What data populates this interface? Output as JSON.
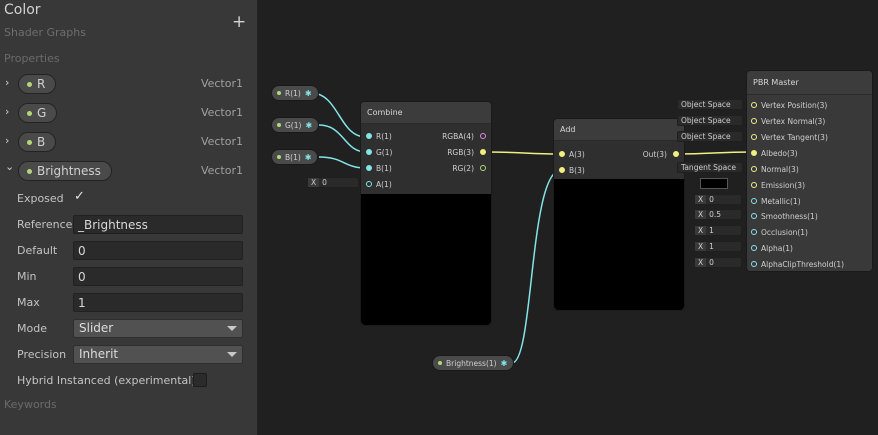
{
  "blackboard": {
    "title": "Color",
    "subtitle": "Shader Graphs",
    "add_label": "+",
    "properties_header": "Properties",
    "keywords_header": "Keywords",
    "properties": [
      {
        "name": "R",
        "type": "Vector1",
        "expanded": false
      },
      {
        "name": "G",
        "type": "Vector1",
        "expanded": false
      },
      {
        "name": "B",
        "type": "Vector1",
        "expanded": false
      },
      {
        "name": "Brightness",
        "type": "Vector1",
        "expanded": true
      }
    ],
    "collapsed_arrow": "›",
    "expanded_arrow": "⌄",
    "fields": {
      "exposed_label": "Exposed",
      "exposed_checked": "✓",
      "reference_label": "Reference",
      "reference_value": "_Brightness",
      "default_label": "Default",
      "default_value": "0",
      "min_label": "Min",
      "min_value": "0",
      "max_label": "Max",
      "max_value": "1",
      "mode_label": "Mode",
      "mode_value": "Slider",
      "precision_label": "Precision",
      "precision_value": "Inherit",
      "hybrid_label": "Hybrid Instanced (experimental)"
    }
  },
  "graph": {
    "prop_nodes": {
      "r": "R(1)",
      "g": "G(1)",
      "b": "B(1)",
      "brightness": "Brightness(1)"
    },
    "combine": {
      "title": "Combine",
      "inputs": [
        "R(1)",
        "G(1)",
        "B(1)",
        "A(1)"
      ],
      "outputs": [
        "RGBA(4)",
        "RGB(3)",
        "RG(2)"
      ],
      "a_field_label": "X",
      "a_field_value": "0"
    },
    "add": {
      "title": "Add",
      "inputs": [
        "A(3)",
        "B(3)"
      ],
      "outputs": [
        "Out(3)"
      ]
    },
    "master": {
      "title": "PBR Master",
      "ports": [
        "Vertex Position(3)",
        "Vertex Normal(3)",
        "Vertex Tangent(3)",
        "Albedo(3)",
        "Normal(3)",
        "Emission(3)",
        "Metallic(1)",
        "Smoothness(1)",
        "Occlusion(1)",
        "Alpha(1)",
        "AlphaClipThreshold(1)"
      ],
      "space_fields": [
        "Object Space",
        "Object Space",
        "Object Space"
      ],
      "tangent_field": "Tangent Space",
      "x_label": "X",
      "metallic_value": "0",
      "smoothness_value": "0.5",
      "occlusion_value": "1",
      "alpha_value": "1",
      "alphaclip_value": "0"
    },
    "colors": {
      "vector1": "#84e4e7",
      "vector3": "#f0f082",
      "vector4": "#e38ad8",
      "vector2": "#b4d67a"
    }
  }
}
